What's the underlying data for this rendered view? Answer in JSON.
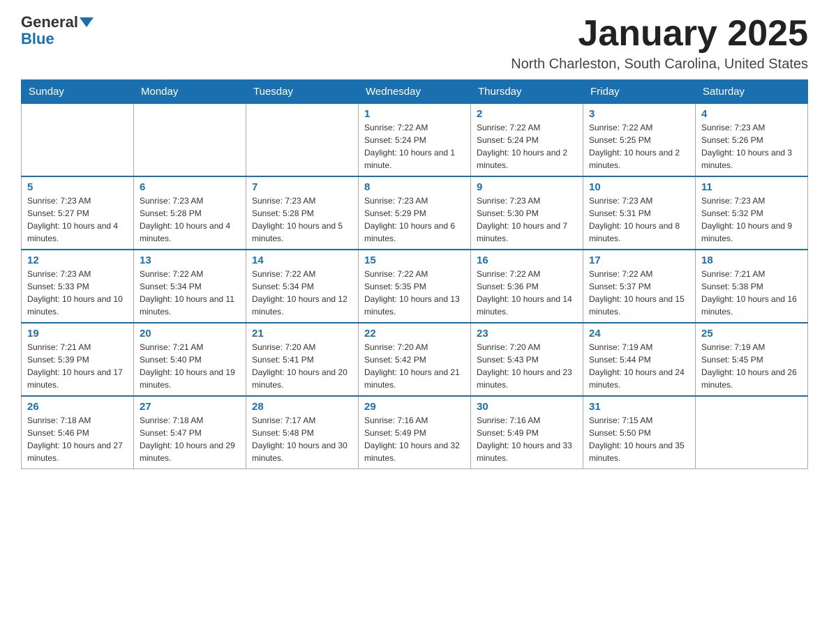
{
  "header": {
    "logo_general": "General",
    "logo_blue": "Blue",
    "month_title": "January 2025",
    "location": "North Charleston, South Carolina, United States"
  },
  "weekdays": [
    "Sunday",
    "Monday",
    "Tuesday",
    "Wednesday",
    "Thursday",
    "Friday",
    "Saturday"
  ],
  "weeks": [
    [
      {
        "day": "",
        "sunrise": "",
        "sunset": "",
        "daylight": ""
      },
      {
        "day": "",
        "sunrise": "",
        "sunset": "",
        "daylight": ""
      },
      {
        "day": "",
        "sunrise": "",
        "sunset": "",
        "daylight": ""
      },
      {
        "day": "1",
        "sunrise": "Sunrise: 7:22 AM",
        "sunset": "Sunset: 5:24 PM",
        "daylight": "Daylight: 10 hours and 1 minute."
      },
      {
        "day": "2",
        "sunrise": "Sunrise: 7:22 AM",
        "sunset": "Sunset: 5:24 PM",
        "daylight": "Daylight: 10 hours and 2 minutes."
      },
      {
        "day": "3",
        "sunrise": "Sunrise: 7:22 AM",
        "sunset": "Sunset: 5:25 PM",
        "daylight": "Daylight: 10 hours and 2 minutes."
      },
      {
        "day": "4",
        "sunrise": "Sunrise: 7:23 AM",
        "sunset": "Sunset: 5:26 PM",
        "daylight": "Daylight: 10 hours and 3 minutes."
      }
    ],
    [
      {
        "day": "5",
        "sunrise": "Sunrise: 7:23 AM",
        "sunset": "Sunset: 5:27 PM",
        "daylight": "Daylight: 10 hours and 4 minutes."
      },
      {
        "day": "6",
        "sunrise": "Sunrise: 7:23 AM",
        "sunset": "Sunset: 5:28 PM",
        "daylight": "Daylight: 10 hours and 4 minutes."
      },
      {
        "day": "7",
        "sunrise": "Sunrise: 7:23 AM",
        "sunset": "Sunset: 5:28 PM",
        "daylight": "Daylight: 10 hours and 5 minutes."
      },
      {
        "day": "8",
        "sunrise": "Sunrise: 7:23 AM",
        "sunset": "Sunset: 5:29 PM",
        "daylight": "Daylight: 10 hours and 6 minutes."
      },
      {
        "day": "9",
        "sunrise": "Sunrise: 7:23 AM",
        "sunset": "Sunset: 5:30 PM",
        "daylight": "Daylight: 10 hours and 7 minutes."
      },
      {
        "day": "10",
        "sunrise": "Sunrise: 7:23 AM",
        "sunset": "Sunset: 5:31 PM",
        "daylight": "Daylight: 10 hours and 8 minutes."
      },
      {
        "day": "11",
        "sunrise": "Sunrise: 7:23 AM",
        "sunset": "Sunset: 5:32 PM",
        "daylight": "Daylight: 10 hours and 9 minutes."
      }
    ],
    [
      {
        "day": "12",
        "sunrise": "Sunrise: 7:23 AM",
        "sunset": "Sunset: 5:33 PM",
        "daylight": "Daylight: 10 hours and 10 minutes."
      },
      {
        "day": "13",
        "sunrise": "Sunrise: 7:22 AM",
        "sunset": "Sunset: 5:34 PM",
        "daylight": "Daylight: 10 hours and 11 minutes."
      },
      {
        "day": "14",
        "sunrise": "Sunrise: 7:22 AM",
        "sunset": "Sunset: 5:34 PM",
        "daylight": "Daylight: 10 hours and 12 minutes."
      },
      {
        "day": "15",
        "sunrise": "Sunrise: 7:22 AM",
        "sunset": "Sunset: 5:35 PM",
        "daylight": "Daylight: 10 hours and 13 minutes."
      },
      {
        "day": "16",
        "sunrise": "Sunrise: 7:22 AM",
        "sunset": "Sunset: 5:36 PM",
        "daylight": "Daylight: 10 hours and 14 minutes."
      },
      {
        "day": "17",
        "sunrise": "Sunrise: 7:22 AM",
        "sunset": "Sunset: 5:37 PM",
        "daylight": "Daylight: 10 hours and 15 minutes."
      },
      {
        "day": "18",
        "sunrise": "Sunrise: 7:21 AM",
        "sunset": "Sunset: 5:38 PM",
        "daylight": "Daylight: 10 hours and 16 minutes."
      }
    ],
    [
      {
        "day": "19",
        "sunrise": "Sunrise: 7:21 AM",
        "sunset": "Sunset: 5:39 PM",
        "daylight": "Daylight: 10 hours and 17 minutes."
      },
      {
        "day": "20",
        "sunrise": "Sunrise: 7:21 AM",
        "sunset": "Sunset: 5:40 PM",
        "daylight": "Daylight: 10 hours and 19 minutes."
      },
      {
        "day": "21",
        "sunrise": "Sunrise: 7:20 AM",
        "sunset": "Sunset: 5:41 PM",
        "daylight": "Daylight: 10 hours and 20 minutes."
      },
      {
        "day": "22",
        "sunrise": "Sunrise: 7:20 AM",
        "sunset": "Sunset: 5:42 PM",
        "daylight": "Daylight: 10 hours and 21 minutes."
      },
      {
        "day": "23",
        "sunrise": "Sunrise: 7:20 AM",
        "sunset": "Sunset: 5:43 PM",
        "daylight": "Daylight: 10 hours and 23 minutes."
      },
      {
        "day": "24",
        "sunrise": "Sunrise: 7:19 AM",
        "sunset": "Sunset: 5:44 PM",
        "daylight": "Daylight: 10 hours and 24 minutes."
      },
      {
        "day": "25",
        "sunrise": "Sunrise: 7:19 AM",
        "sunset": "Sunset: 5:45 PM",
        "daylight": "Daylight: 10 hours and 26 minutes."
      }
    ],
    [
      {
        "day": "26",
        "sunrise": "Sunrise: 7:18 AM",
        "sunset": "Sunset: 5:46 PM",
        "daylight": "Daylight: 10 hours and 27 minutes."
      },
      {
        "day": "27",
        "sunrise": "Sunrise: 7:18 AM",
        "sunset": "Sunset: 5:47 PM",
        "daylight": "Daylight: 10 hours and 29 minutes."
      },
      {
        "day": "28",
        "sunrise": "Sunrise: 7:17 AM",
        "sunset": "Sunset: 5:48 PM",
        "daylight": "Daylight: 10 hours and 30 minutes."
      },
      {
        "day": "29",
        "sunrise": "Sunrise: 7:16 AM",
        "sunset": "Sunset: 5:49 PM",
        "daylight": "Daylight: 10 hours and 32 minutes."
      },
      {
        "day": "30",
        "sunrise": "Sunrise: 7:16 AM",
        "sunset": "Sunset: 5:49 PM",
        "daylight": "Daylight: 10 hours and 33 minutes."
      },
      {
        "day": "31",
        "sunrise": "Sunrise: 7:15 AM",
        "sunset": "Sunset: 5:50 PM",
        "daylight": "Daylight: 10 hours and 35 minutes."
      },
      {
        "day": "",
        "sunrise": "",
        "sunset": "",
        "daylight": ""
      }
    ]
  ]
}
